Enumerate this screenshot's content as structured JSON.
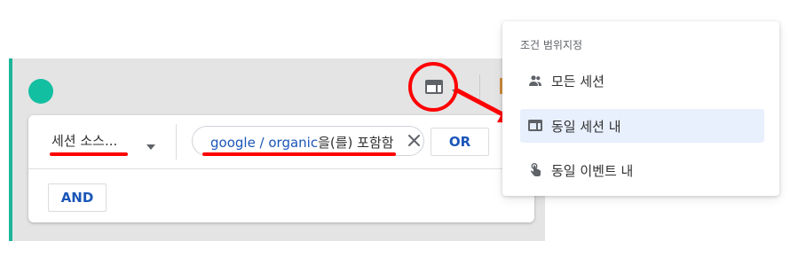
{
  "segment": {
    "dimension": {
      "label": "세션 소스..."
    },
    "condition": {
      "value": "google / organic",
      "suffix": "을(를) 포함함"
    },
    "or_label": "OR",
    "and_label": "AND"
  },
  "scope_menu": {
    "title": "조건 범위지정",
    "items": [
      {
        "label": "모든 세션",
        "icon": "people-icon"
      },
      {
        "label": "동일 세션 내",
        "icon": "session-icon",
        "selected": true
      },
      {
        "label": "동일 이벤트 내",
        "icon": "touch-icon"
      }
    ]
  },
  "colors": {
    "accent": "#1bb59a",
    "annotation": "#ff0000",
    "link_blue": "#1a56b8",
    "selected_bg": "#e8f0fe"
  }
}
